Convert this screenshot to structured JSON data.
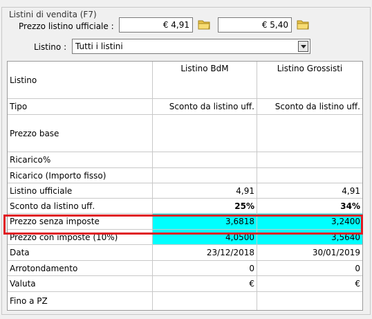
{
  "group_title": "Listini di vendita (F7)",
  "prezzo_listino": {
    "label": "Prezzo listino ufficiale :",
    "value1": "€ 4,91",
    "value2": "€ 5,40"
  },
  "listino_filter": {
    "label": "Listino :",
    "selected": "Tutti i listini"
  },
  "table": {
    "header": [
      "Listino",
      "Listino BdM",
      "Listino Grossisti"
    ],
    "rows": [
      {
        "label": "Tipo",
        "v1": "Sconto da listino uff.",
        "v2": "Sconto da listino uff."
      },
      {
        "label": "Prezzo base",
        "v1": "",
        "v2": ""
      },
      {
        "label": "Ricarico%",
        "v1": "",
        "v2": ""
      },
      {
        "label": "Ricarico (Importo fisso)",
        "v1": "",
        "v2": ""
      },
      {
        "label": "Listino ufficiale",
        "v1": "4,91",
        "v2": "4,91"
      },
      {
        "label": "Sconto da listino uff.",
        "v1": "25%",
        "v2": "34%"
      },
      {
        "label": "Prezzo senza imposte",
        "v1": "3,6818",
        "v2": "3,2400"
      },
      {
        "label": "Prezzo con imposte (10%)",
        "v1": "4,0500",
        "v2": "3,5640"
      },
      {
        "label": "Data",
        "v1": "23/12/2018",
        "v2": "30/01/2019"
      },
      {
        "label": "Arrotondamento",
        "v1": "0",
        "v2": "0"
      },
      {
        "label": "Valuta",
        "v1": "€",
        "v2": "€"
      },
      {
        "label": "Fino a PZ",
        "v1": "",
        "v2": ""
      }
    ]
  },
  "colors": {
    "cyan_cells": "#00ffff",
    "highlight_border": "#e01a22"
  }
}
